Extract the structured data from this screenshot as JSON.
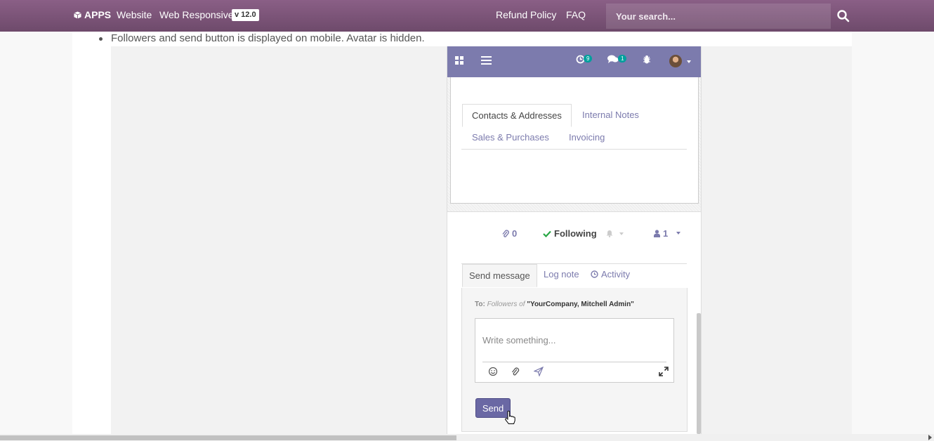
{
  "topbar": {
    "brand": "APPS",
    "brand_icon": "cube-icon",
    "links": [
      "Website",
      "Web Responsive"
    ],
    "version_badge": "v 12.0",
    "right_links": [
      "Refund Policy",
      "FAQ"
    ],
    "search_placeholder": "Your search...",
    "search_icon": "search-icon"
  },
  "content": {
    "bullet": "Followers and send button is displayed on mobile. Avatar is hidden."
  },
  "phone": {
    "nav": {
      "activity_count": "9",
      "message_count": "1"
    },
    "form_tabs": [
      "Contacts & Addresses",
      "Internal Notes",
      "Sales & Purchases",
      "Invoicing"
    ],
    "chatter": {
      "attachments_count": "0",
      "following_label": "Following",
      "followers_count": "1",
      "tabs": [
        "Send message",
        "Log note",
        "Activity"
      ],
      "to_label": "To:",
      "to_followers_of": "Followers of",
      "to_record": "\"YourCompany, Mitchell Admin\"",
      "composer_placeholder": "Write something...",
      "send_label": "Send"
    }
  },
  "colors": {
    "topbar": "#7d5479",
    "phone_nav": "#7c7bad",
    "link": "#7c7bad",
    "send_button": "#6a68a4",
    "badge": "#00a09d",
    "check": "#28a745"
  }
}
